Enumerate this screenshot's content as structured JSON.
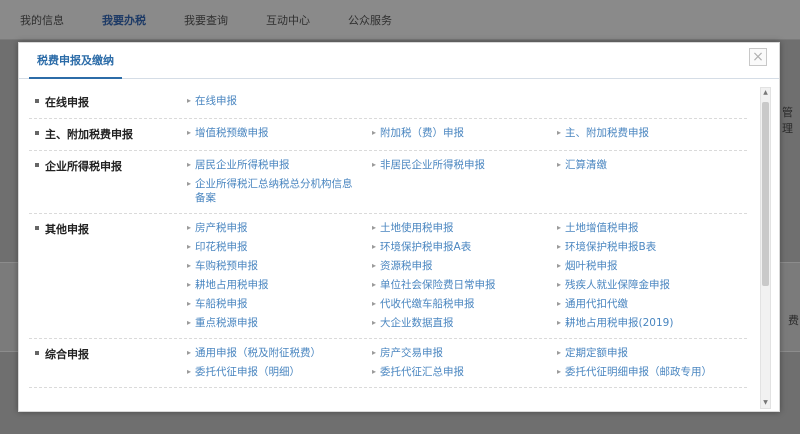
{
  "nav": {
    "items": [
      {
        "label": "我的信息"
      },
      {
        "label": "我要办税"
      },
      {
        "label": "我要查询"
      },
      {
        "label": "互动中心"
      },
      {
        "label": "公众服务"
      }
    ]
  },
  "background": {
    "right_fragment": "管理",
    "right_fragment2": "费"
  },
  "modal": {
    "title": "税费申报及缴纳",
    "close": "×",
    "sections": [
      {
        "title": "在线申报",
        "items": [
          "在线申报"
        ]
      },
      {
        "title": "主、附加税费申报",
        "items": [
          "增值税预缴申报",
          "附加税（费）申报",
          "主、附加税费申报"
        ]
      },
      {
        "title": "企业所得税申报",
        "items": [
          "居民企业所得税申报",
          "非居民企业所得税申报",
          "汇算清缴",
          "企业所得税汇总纳税总分机构信息备案"
        ]
      },
      {
        "title": "其他申报",
        "items": [
          "房产税申报",
          "土地使用税申报",
          "土地增值税申报",
          "印花税申报",
          "环境保护税申报A表",
          "环境保护税申报B表",
          "车购税预申报",
          "资源税申报",
          "烟叶税申报",
          "耕地占用税申报",
          "单位社会保险费日常申报",
          "残疾人就业保障金申报",
          "车船税申报",
          "代收代缴车船税申报",
          "通用代扣代缴",
          "重点税源申报",
          "大企业数据直报",
          "耕地占用税申报(2019)"
        ]
      },
      {
        "title": "综合申报",
        "items": [
          "通用申报（税及附征税费）",
          "房产交易申报",
          "定期定额申报",
          "委托代征申报（明细）",
          "委托代征汇总申报",
          "委托代征明细申报（邮政专用）"
        ]
      }
    ]
  }
}
